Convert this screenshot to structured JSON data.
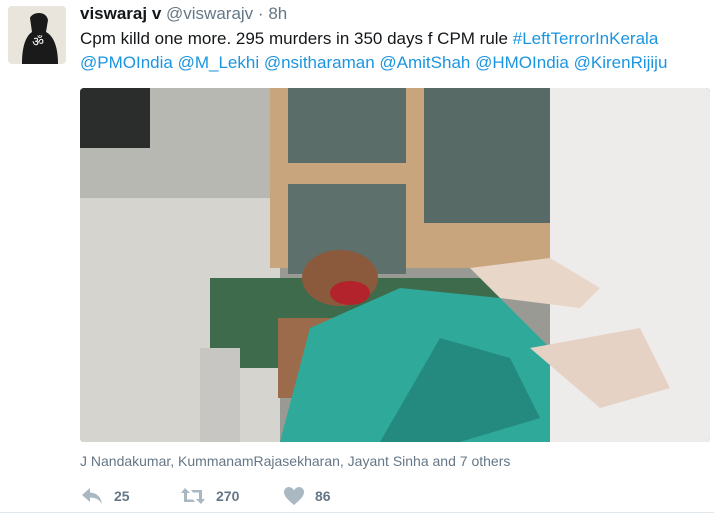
{
  "tweet": {
    "display_name": "viswaraj v",
    "handle": "@viswarajv",
    "separator": "·",
    "time": "8h",
    "text_plain": "Cpm killd one more. 295 murders in 350 days f CPM rule ",
    "hashtag": "#LeftTerrorInKerala",
    "mentions": [
      "@PMOIndia",
      "@M_Lekhi",
      "@nsitharaman",
      "@AmitShah",
      "@HMOIndia",
      "@KirenRijiju"
    ],
    "tagged_people": "J Nandakumar, KummanamRajasekharan, Jayant Sinha and 7 others",
    "reply_count": "25",
    "retweet_count": "270",
    "like_count": "86"
  },
  "colors": {
    "link": "#1b95e0",
    "secondary_text": "#657786",
    "icon": "#aab8c2"
  },
  "icons": {
    "reply": "reply-icon",
    "retweet": "retweet-icon",
    "like": "heart-icon",
    "avatar": "om-symbol-avatar"
  }
}
